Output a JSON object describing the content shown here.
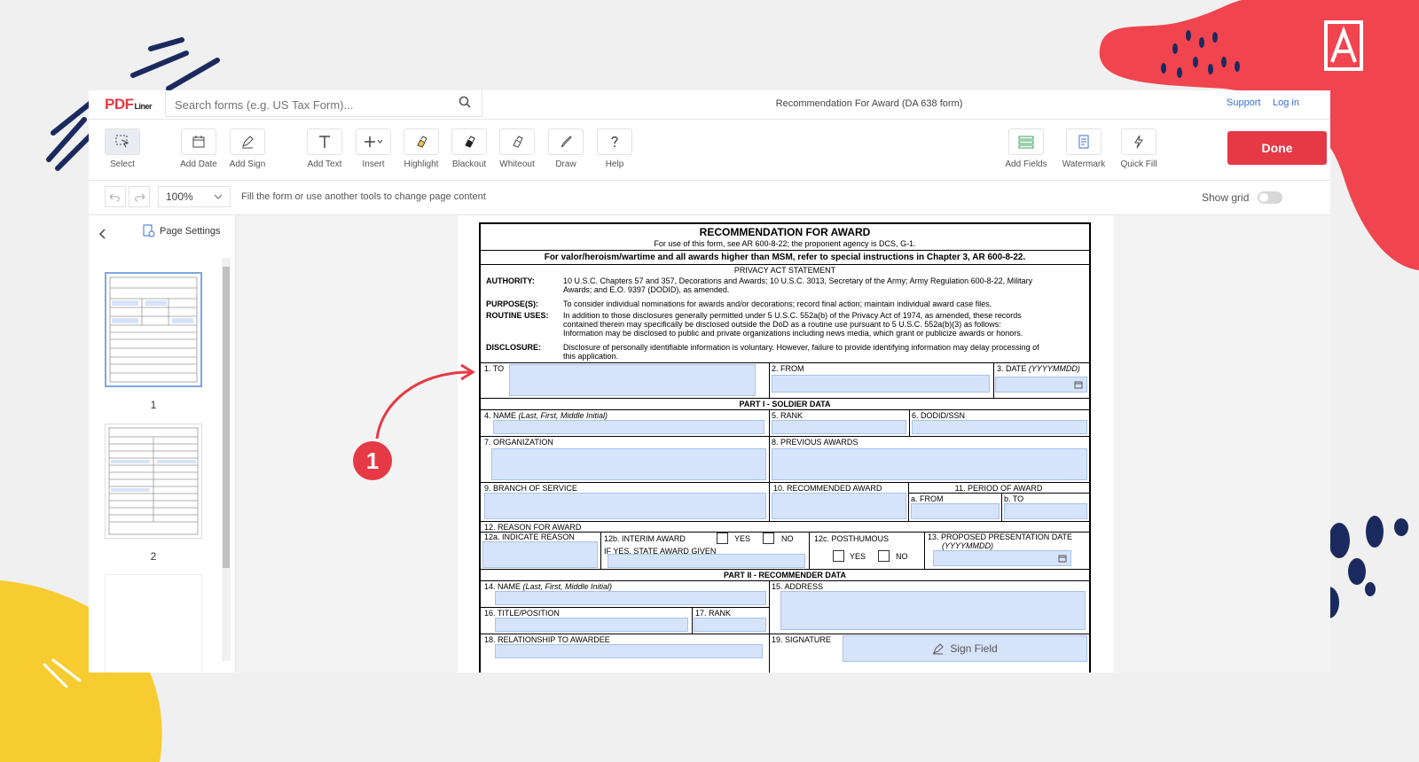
{
  "brand": {
    "logo_main": "PDF",
    "logo_sub": "Liner"
  },
  "search": {
    "placeholder": "Search forms (e.g. US Tax Form)..."
  },
  "header": {
    "title": "Recommendation For Award (DA 638 form)",
    "support": "Support",
    "login": "Log in"
  },
  "toolbar": {
    "select": "Select",
    "add_date": "Add Date",
    "add_sign": "Add Sign",
    "add_text": "Add Text",
    "insert": "Insert",
    "highlight": "Highlight",
    "blackout": "Blackout",
    "whiteout": "Whiteout",
    "draw": "Draw",
    "help": "Help",
    "add_fields": "Add Fields",
    "watermark": "Watermark",
    "quick_fill": "Quick Fill",
    "done": "Done"
  },
  "subbar": {
    "zoom": "100%",
    "hint": "Fill the form or use another tools to change page content",
    "show_grid": "Show grid"
  },
  "sidebar": {
    "page_settings": "Page Settings",
    "pages": [
      "1",
      "2"
    ]
  },
  "callout": "1",
  "colors": {
    "accent": "#e63946",
    "field_fill": "#d6e4fb"
  },
  "form": {
    "title": "RECOMMENDATION FOR AWARD",
    "subtitle": "For use of this form, see AR 600-8-22; the proponent agency is DCS, G-1.",
    "notice": "For valor/heroism/wartime and all awards higher than MSM, refer to special instructions in Chapter 3, AR 600-8-22.",
    "privacy_title": "PRIVACY ACT STATEMENT",
    "authority_label": "AUTHORITY:",
    "authority_text_1": "10 U.S.C. Chapters 57 and 357, Decorations and Awards; 10 U.S.C. 3013, Secretary of the Army; Army Regulation 600-8-22, Military",
    "authority_text_2": "Awards; and E.O. 9397 (DODID), as amended.",
    "purpose_label": "PURPOSE(S):",
    "purpose_text": "To consider individual nominations for awards and/or decorations; record final action; maintain individual award case files.",
    "routine_label": "ROUTINE USES:",
    "routine_text_1": "In addition to those disclosures generally permitted under 5 U.S.C. 552a(b) of the Privacy Act of 1974, as amended, these records",
    "routine_text_2": "contained therein may specifically be disclosed outside the DoD as a routine use pursuant to 5 U.S.C. 552a(b)(3) as follows:",
    "routine_text_3": "Information may be disclosed to public and private organizations including news media, which grant or publicize awards or honors.",
    "disclosure_label": "DISCLOSURE:",
    "disclosure_text_1": "Disclosure of personally identifiable information is voluntary. However, failure to provide identifying information may delay processing of",
    "disclosure_text_2": "this application.",
    "f1": "1. TO",
    "f2": "2. FROM",
    "f3": "3. DATE",
    "f3_fmt": "(YYYYMMDD)",
    "part1": "PART I - SOLDIER DATA",
    "f4": "4. NAME",
    "f4_sub": "(Last, First, Middle Initial)",
    "f5": "5. RANK",
    "f6": "6. DODID/SSN",
    "f7": "7. ORGANIZATION",
    "f8": "8. PREVIOUS AWARDS",
    "f9": "9. BRANCH OF SERVICE",
    "f10": "10. RECOMMENDED AWARD",
    "f11": "11. PERIOD OF AWARD",
    "f11a": "a. FROM",
    "f11b": "b. TO",
    "f12": "12. REASON FOR AWARD",
    "f12a": "12a. INDICATE REASON",
    "f12b": "12b. INTERIM AWARD",
    "yes": "YES",
    "no": "NO",
    "f12b_sub": "IF YES, STATE AWARD GIVEN",
    "f12c": "12c. POSTHUMOUS",
    "f13": "13. PROPOSED PRESENTATION DATE",
    "f13_fmt": "(YYYYMMDD)",
    "part2": "PART II - RECOMMENDER DATA",
    "f14": "14. NAME",
    "f14_sub": "(Last, First, Middle Initial)",
    "f15": "15. ADDRESS",
    "f16": "16. TITLE/POSITION",
    "f17": "17. RANK",
    "f18": "18. RELATIONSHIP TO AWARDEE",
    "f19": "19. SIGNATURE",
    "sign_field": "Sign Field"
  }
}
